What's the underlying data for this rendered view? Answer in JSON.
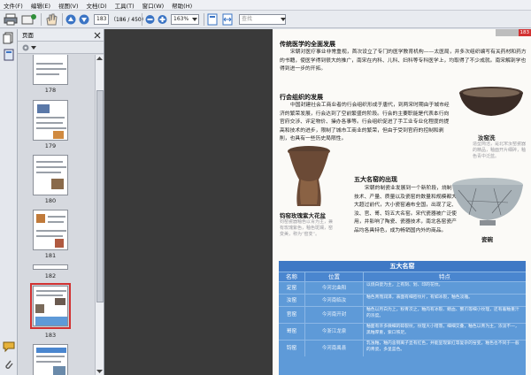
{
  "menu": [
    "文件(F)",
    "编辑(E)",
    "视图(V)",
    "文档(D)",
    "工具(T)",
    "窗口(W)",
    "帮助(H)"
  ],
  "toolbar": {
    "page_current": "183",
    "page_total": "（186 / 450）",
    "zoom": "163%",
    "search_placeholder": "查找"
  },
  "panel": {
    "title": "页面",
    "thumbnails": [
      {
        "label": "178"
      },
      {
        "label": "179"
      },
      {
        "label": "180"
      },
      {
        "label": "181"
      },
      {
        "label": "182"
      },
      {
        "label": "183",
        "selected": true
      },
      {
        "label": "184"
      }
    ]
  },
  "document": {
    "header_tab": "183",
    "section1_title": "传统医学的全面发展",
    "section1_body": "宋朝对医疗事业非常重视，首次设立了专门的医学教育机构——太医局，并多次组织编写有关药材和药方的书籍，使医学得到很大的推广，南宋在内科、儿科、妇科等专科医学上，均取得了不少成就。南宋解剖学也得到进一步的开拓。",
    "section2_title": "行会组织的发展",
    "section2_body": "中国封建社会工商业者的行会组织形成于唐代，到两宋时期由于城市经济的繁荣发展，行会达到了空前繁盛的阶段。行会的主要职能是代表本行向官府交涉、评定物价、操办各事等。行会组织促进了手工业专业化程度的提高和技术的进步，限制了城市工商业的繁荣，但由于受到官府的控制和剥削，也具有一些历史局限性。",
    "section3_title": "五大名窑的出现",
    "section3_body": "宋朝的制瓷业发展到一个新阶段，烧制技术、产量、质量以及瓷窑的数量和规模都大大超过前代，大小瓷窑遍布全国，出现了定、汝、官、哥、钧五大名窑。宋代瓷器被广泛使用，并影响了陶瓷、瓷器技术，南北各窑瓷产品均各具特色，成为畅销国内外的商品。",
    "caption_rujiao": "汝窑洗",
    "caption_rujiao_sub": "造型简洁，是北宋汝窑瓷器的精品，釉面开片细碎，釉色青中泛蓝。",
    "caption_dingzun": "钧窑玫瑰紫大花盆",
    "caption_dingzun_sub": "钧窑瓷器釉色以青为主，兼有玫瑰紫色，釉色斑斓，窑变美，称为“窑变”。",
    "caption_gewan": "瓷碗"
  },
  "table": {
    "title": "五大名窑",
    "headers": [
      "名称",
      "位置",
      "特点"
    ],
    "rows": [
      {
        "name": "定窑",
        "place": "今河北曲阳",
        "feature": "以烧白瓷为主，上有刻、划、印的花纹。"
      },
      {
        "name": "汝窑",
        "place": "今河南临汝",
        "feature": "釉色青而润泽，表面有细密纹片，有如冰裂，釉色淡雅。"
      },
      {
        "name": "官窑",
        "place": "今河南开封",
        "feature": "釉色以月白为上，粉青次之，釉肉有冰裂、鳝血、蟹爪等细小纹理，还有着釉重汁的浓度。"
      },
      {
        "name": "哥窑",
        "place": "今浙江龙泉",
        "feature": "釉面有许多微细的碎裂纹，纹理大小错落，细细交叠，釉色以青为主，浓淡不一，黑釉厚重，紫口铁足。"
      },
      {
        "name": "钧窑",
        "place": "今河南禹县",
        "feature": "乳浊釉，釉内含铜离子显有红色，并能呈现紫红等复杂的窑变，釉色也不同于一般的青瓷，多呈蓝色。"
      }
    ]
  },
  "colors": {
    "table_bg": "#5e9ad8",
    "table_header": "#3f79c5",
    "selected_thumb": "#d23232",
    "dark_gap": "#3a3a3a"
  }
}
